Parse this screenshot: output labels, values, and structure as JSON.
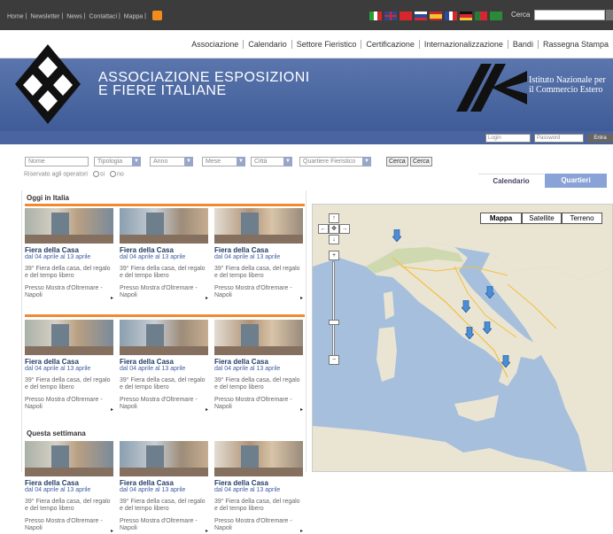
{
  "topbar": {
    "links": [
      "Home",
      "Newsletter",
      "News",
      "Contattaci",
      "Mappa"
    ],
    "separator": "|",
    "search_label": "Cerca",
    "search_placeholder": ""
  },
  "menu": {
    "items": [
      "Associazione",
      "Calendario",
      "Settore Fieristico",
      "Certificazione",
      "Internazionalizzazione",
      "Bandi",
      "Rassegna Stampa"
    ]
  },
  "banner": {
    "title_line1": "ASSOCIAZIONE ESPOSIZIONI",
    "title_line2": "E FIERE ITALIANE",
    "partner_line1": "Istituto Nazionale per",
    "partner_line2": "il Commercio Estero"
  },
  "login": {
    "user_placeholder": "Login",
    "password_placeholder": "Password",
    "submit_label": "Entra"
  },
  "filters": {
    "name_placeholder": "Nome",
    "tipologia": "Tipologia",
    "anno": "Anno",
    "mese": "Mese",
    "citta": "Città",
    "quartiere": "Quartiere Fieristico",
    "search1": "Cerca",
    "search2": "Cerca",
    "reserved_label": "Riservato agli operatori",
    "yes": "si",
    "no": "no"
  },
  "tabs": {
    "calendar": "Calendario",
    "quarters": "Quartieri"
  },
  "sections": {
    "today": "Oggi in Italia",
    "week": "Questa settimana"
  },
  "event": {
    "title": "Fiera della Casa",
    "dates": "dal 04 aprile al 13 aprile",
    "desc": "39° Fiera della casa, del regalo e del tempo libero",
    "place": "Presso Mostra d'Oltremare - Napoli",
    "more": "▸"
  },
  "map": {
    "types": [
      "Mappa",
      "Satellite",
      "Terreno"
    ],
    "selected": "Mappa",
    "pins": 6
  },
  "colors": {
    "banner": "#4e6aa6",
    "accent": "#f08a30",
    "link": "#3e5ea0",
    "tab_active": "#8aa3d6"
  }
}
